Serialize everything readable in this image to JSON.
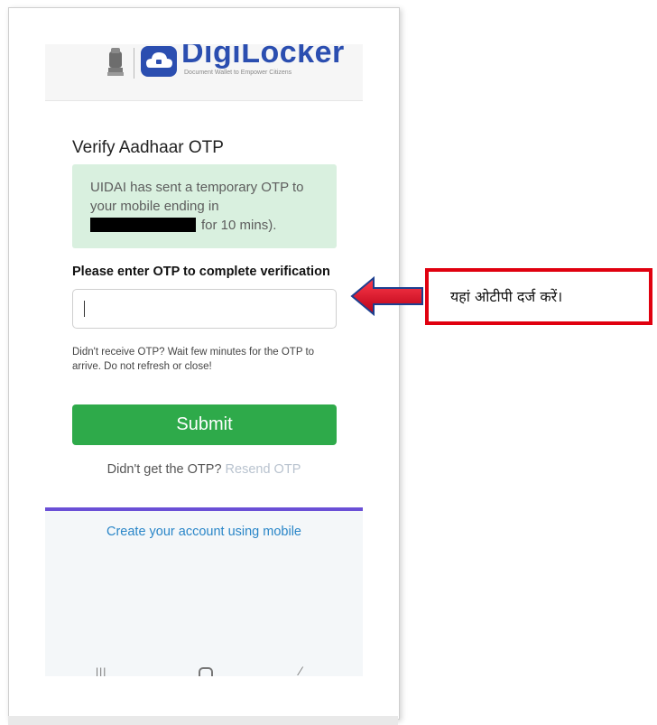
{
  "brand": {
    "name": "DigiLocker",
    "tagline": "Document Wallet to Empower Citizens",
    "accent": "#2b4eb0"
  },
  "page": {
    "title": "Verify Aadhaar OTP"
  },
  "info": {
    "line1": "UIDAI has sent a temporary OTP to",
    "line2": "your mobile ending in",
    "line3_suffix": "for 10 mins).",
    "background": "#d9f0df"
  },
  "form": {
    "otp_label": "Please enter OTP to complete verification",
    "otp_value": "",
    "otp_placeholder": "",
    "help_text": "Didn't receive OTP? Wait few minutes for the OTP to arrive. Do not refresh or close!",
    "submit_label": "Submit",
    "submit_color": "#2eaa4a"
  },
  "resend": {
    "prefix": "Didn't get the OTP?",
    "link": "Resend OTP"
  },
  "footer": {
    "create_link": "Create your account using mobile",
    "accent_line": "#6a4fd6"
  },
  "system_nav": {
    "recent": "|||",
    "home": "home-icon",
    "back": "back-icon"
  },
  "annotation": {
    "text": "यहां ओटीपी दर्ज करें।",
    "border_color": "#e0000f",
    "arrow_color": "#c8001a"
  }
}
